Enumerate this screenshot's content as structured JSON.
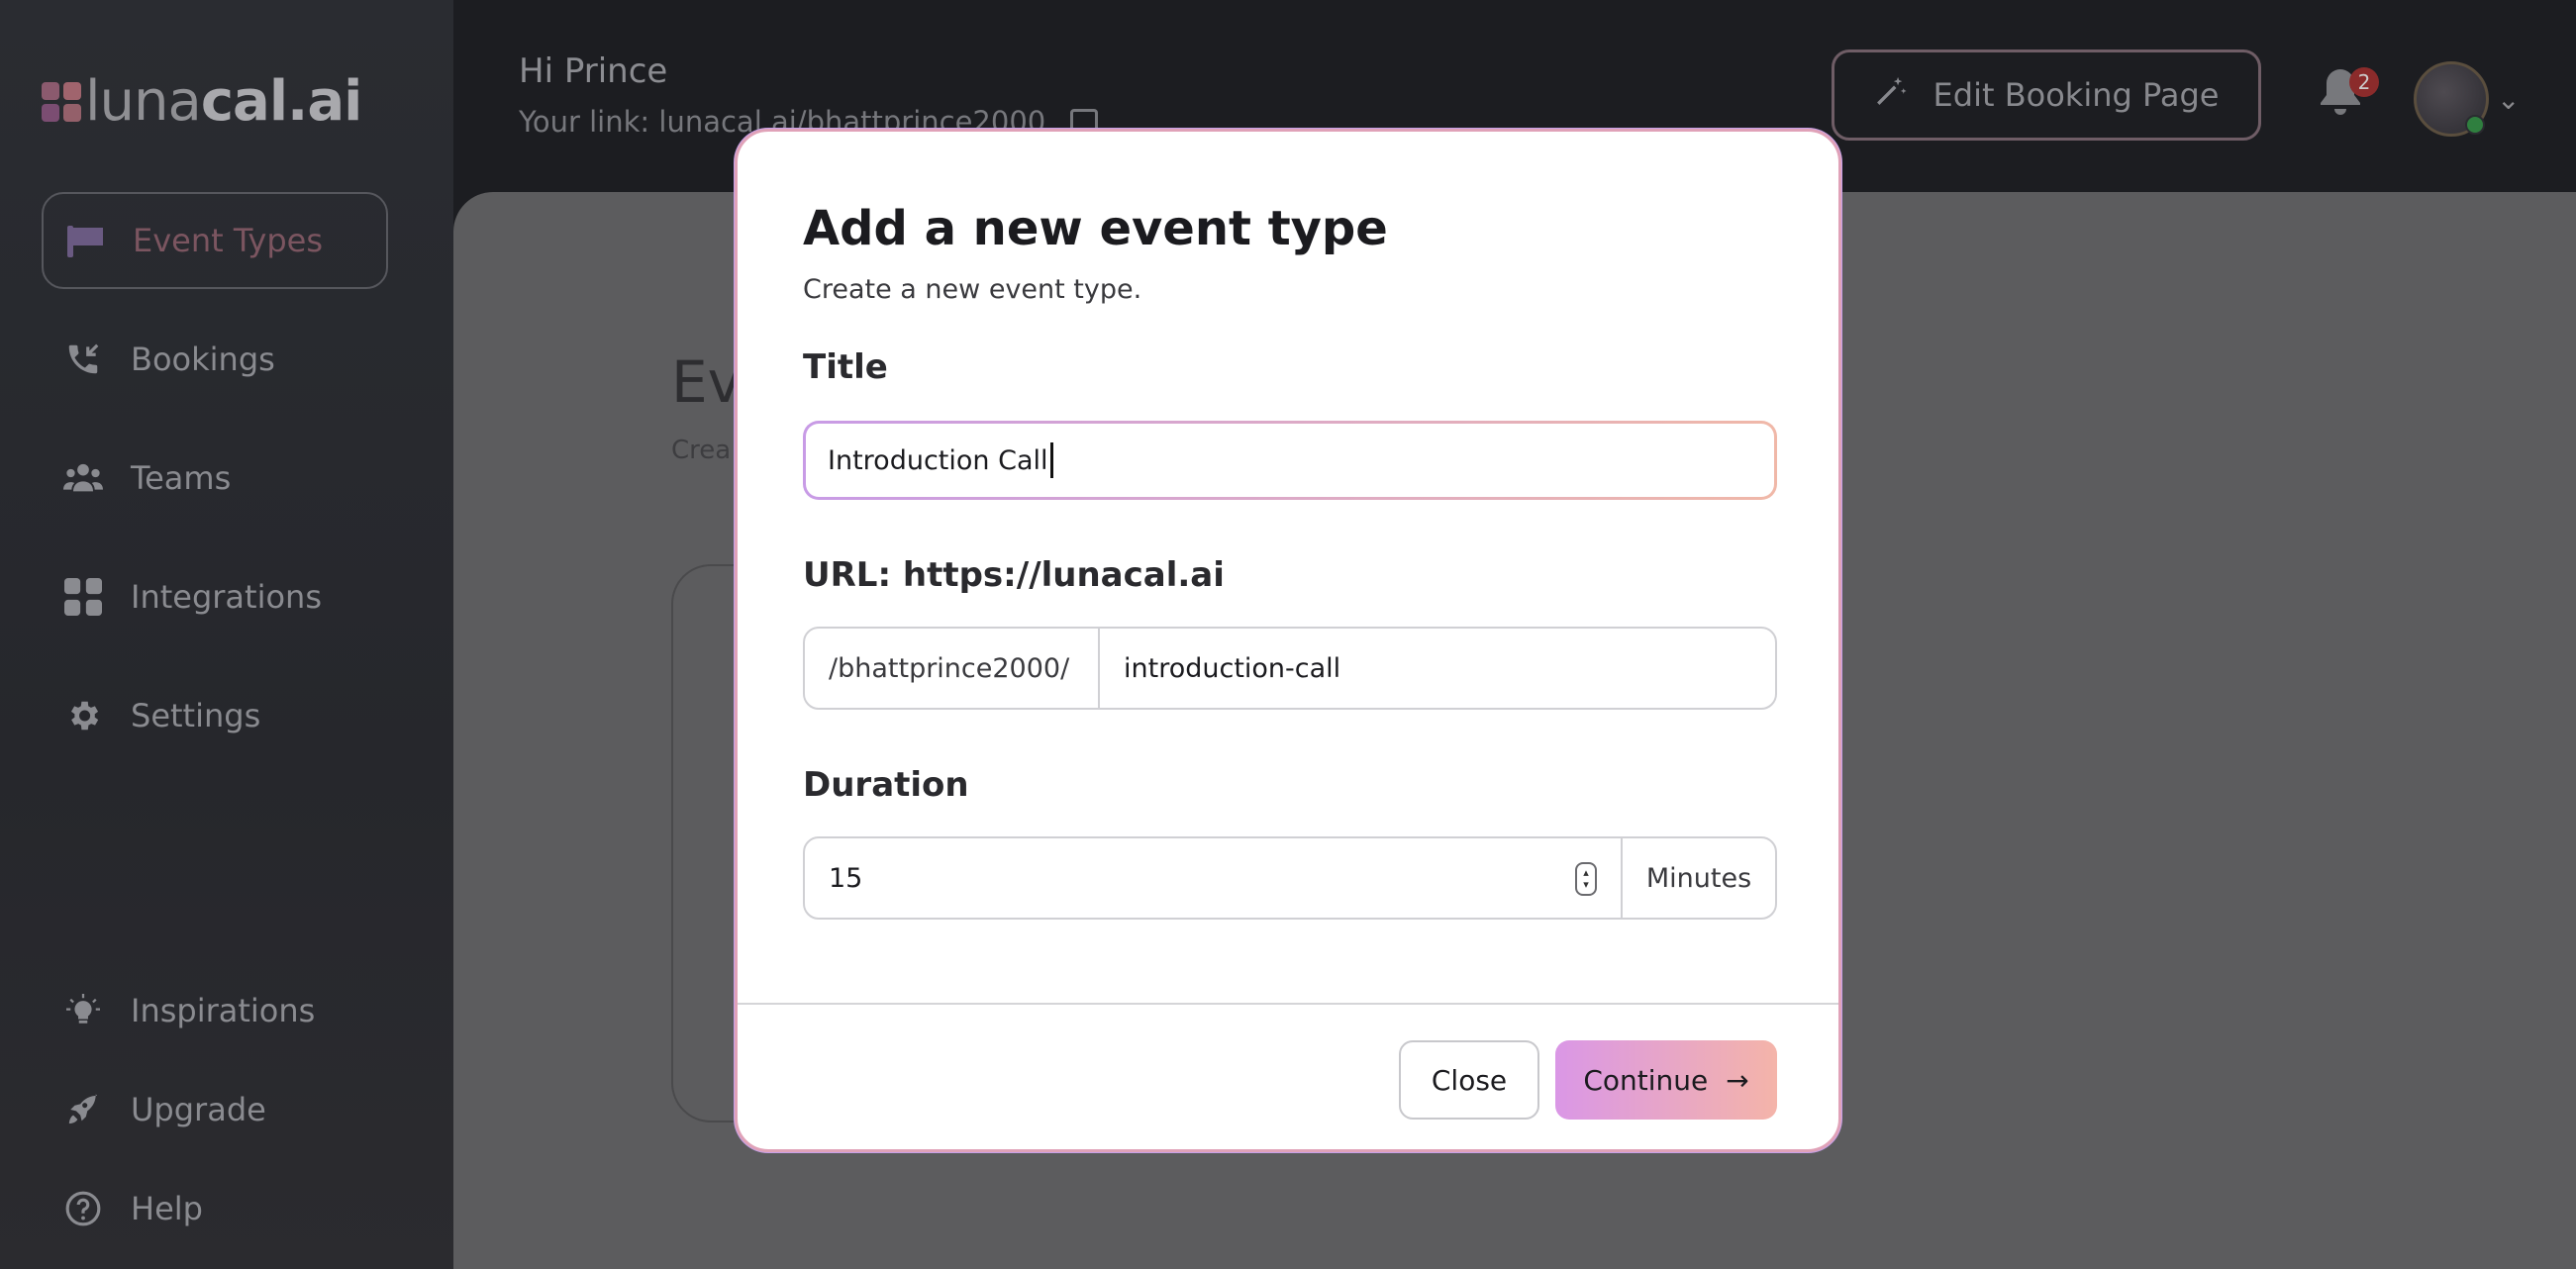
{
  "app": {
    "logo_text_light": "luna",
    "logo_text_bold": "cal.ai"
  },
  "header": {
    "greeting": "Hi Prince",
    "link": "Your link: lunacal.ai/bhattprince2000",
    "edit_booking_label": "Edit Booking Page",
    "notification_count": "2"
  },
  "sidebar": {
    "items": [
      {
        "label": "Event Types",
        "icon": "flag-icon"
      },
      {
        "label": "Bookings",
        "icon": "phone-incoming-icon"
      },
      {
        "label": "Teams",
        "icon": "users-icon"
      },
      {
        "label": "Integrations",
        "icon": "grid-icon"
      },
      {
        "label": "Settings",
        "icon": "gear-icon"
      }
    ],
    "bottom_items": [
      {
        "label": "Inspirations",
        "icon": "lightbulb-icon"
      },
      {
        "label": "Upgrade",
        "icon": "rocket-icon"
      },
      {
        "label": "Help",
        "icon": "help-circle-icon"
      }
    ]
  },
  "background": {
    "title": "Ev",
    "subtitle": "Crea"
  },
  "modal": {
    "title": "Add a new event type",
    "subtitle": "Create a new event type.",
    "title_label": "Title",
    "title_value": "Introduction Call",
    "url_label": "URL: https://lunacal.ai",
    "url_prefix": "/bhattprince2000/",
    "url_slug": "introduction-call",
    "duration_label": "Duration",
    "duration_value": "15",
    "duration_unit": "Minutes",
    "close_label": "Close",
    "continue_label": "Continue"
  }
}
